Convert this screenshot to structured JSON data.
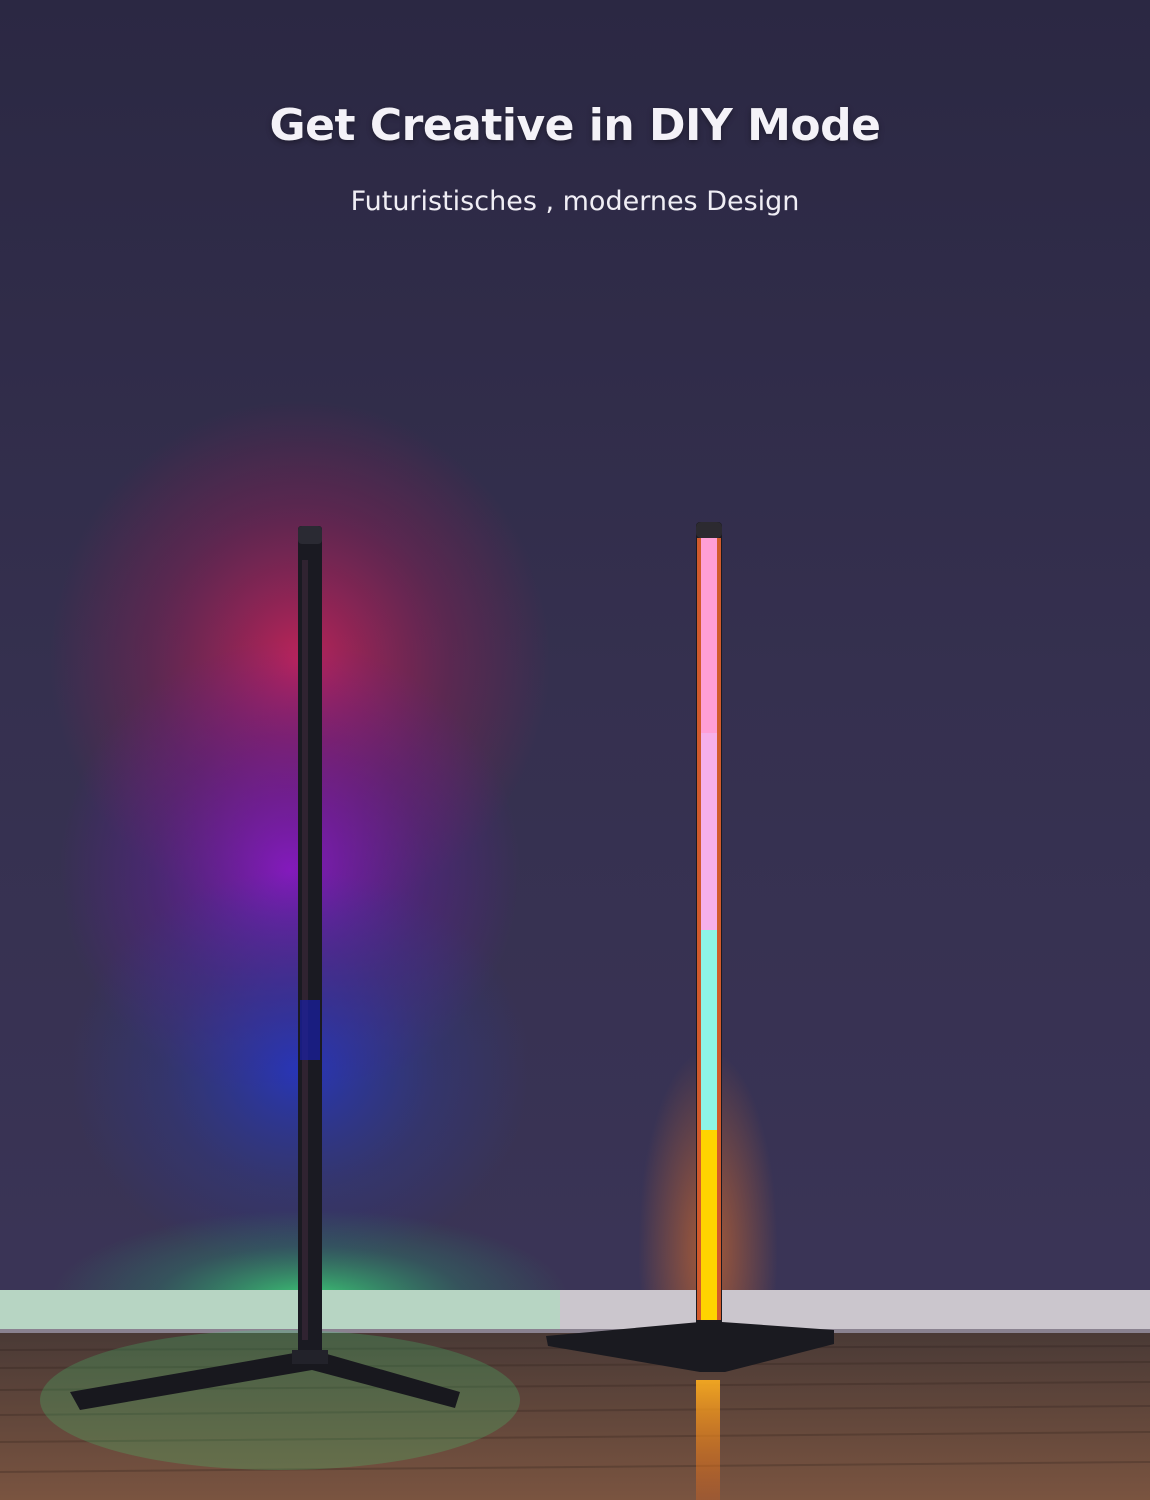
{
  "headline": "Get Creative in DIY Mode",
  "subline": "Futuristisches , modernes Design",
  "colors": {
    "wall": "#34304d",
    "floor": "#6a4a3c",
    "baseboard": "#c9c4cc",
    "left_glow_red": "#c0204a",
    "left_glow_purple": "#7a1ab0",
    "left_glow_blue": "#2030c0",
    "left_glow_green": "#30d070",
    "right_segment_pink": "#ff9fd6",
    "right_segment_lavender": "#f6b0ea",
    "right_segment_aqua": "#8ef4e6",
    "right_segment_yellow": "#ffd400"
  }
}
